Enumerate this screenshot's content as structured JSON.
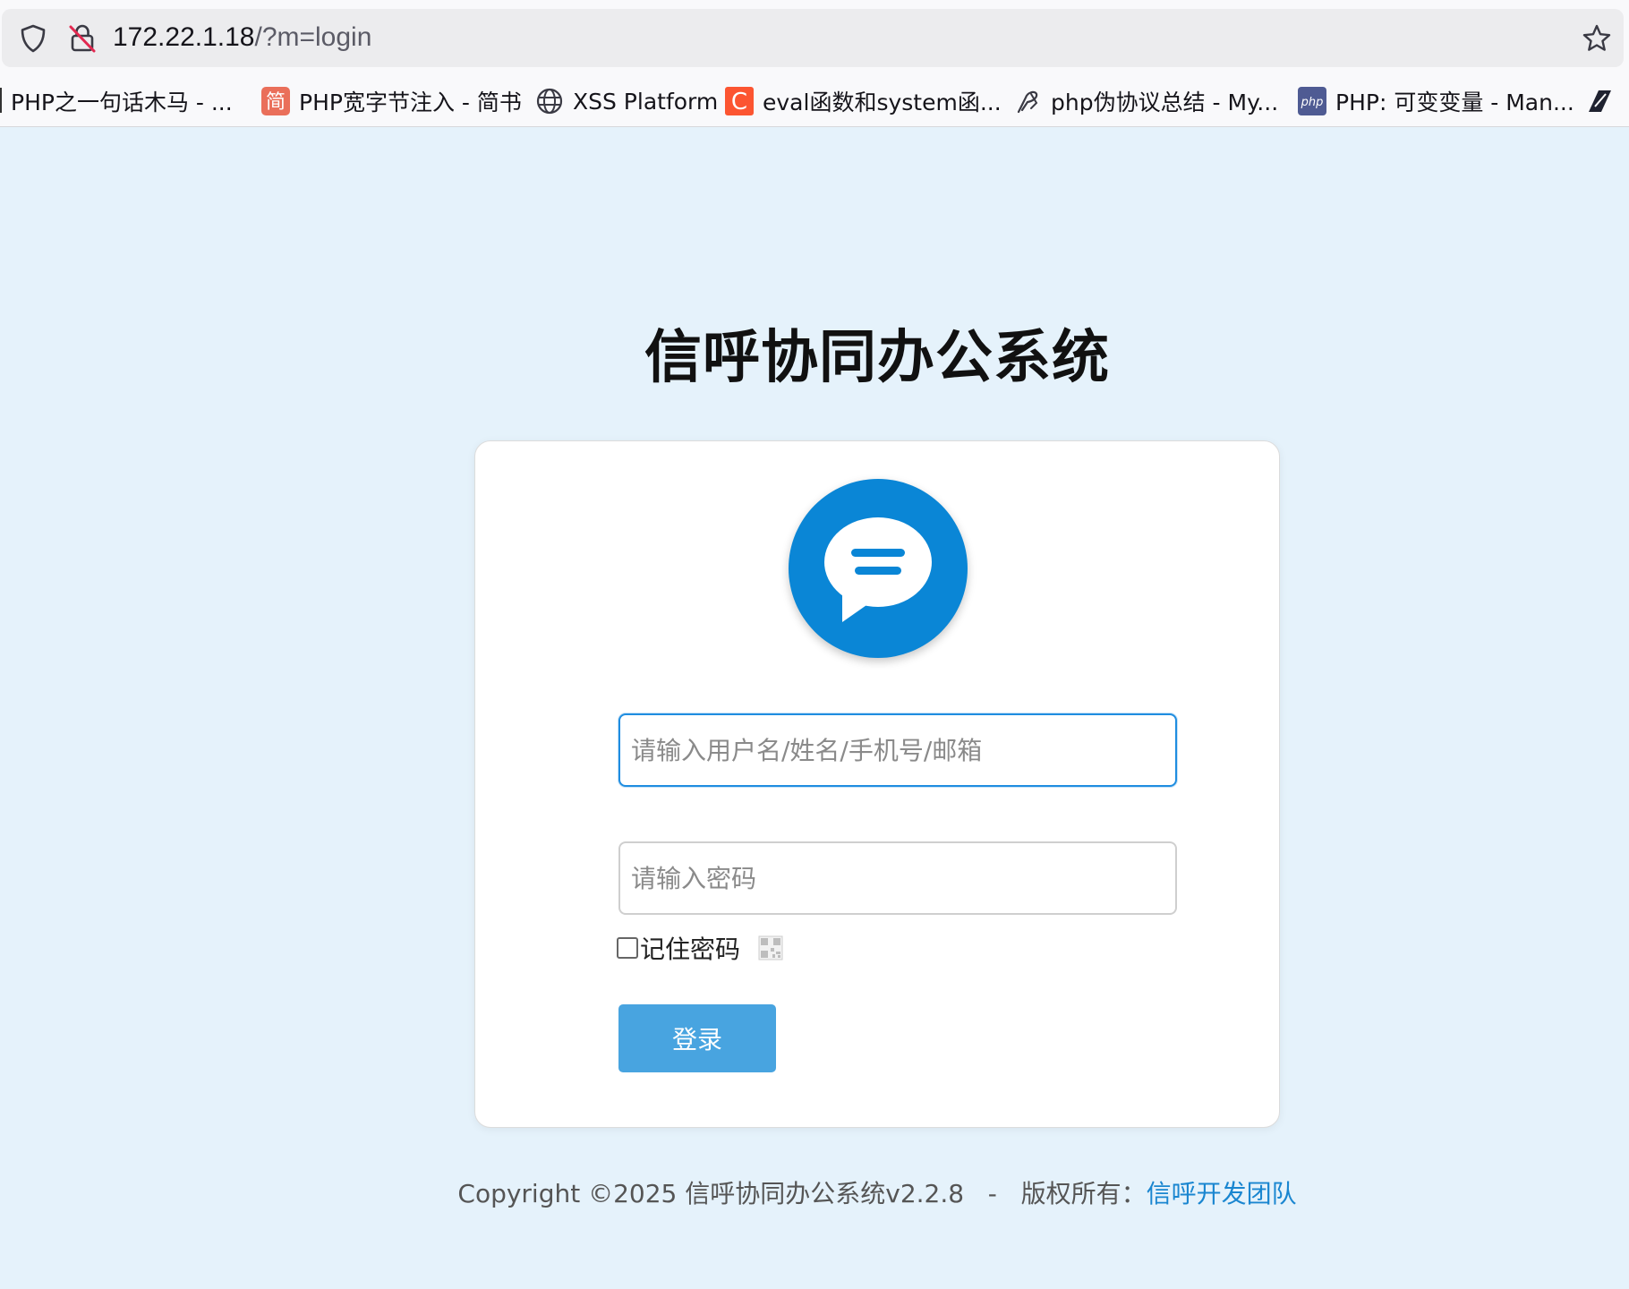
{
  "browser": {
    "url_host": "172.22.1.18",
    "url_path": "/?m=login",
    "bookmarks": [
      {
        "label": "PHP之一句话木马 - ...",
        "icon": "none"
      },
      {
        "label": "PHP宽字节注入 - 简书",
        "icon": "jianshu-icon",
        "icon_text": "简"
      },
      {
        "label": "XSS Platform",
        "icon": "globe-icon"
      },
      {
        "label": "eval函数和system函...",
        "icon": "csdn-icon",
        "icon_text": "C"
      },
      {
        "label": "php伪协议总结 - My...",
        "icon": "feather-icon"
      },
      {
        "label": "PHP: 可变变量 - Man...",
        "icon": "php-icon",
        "icon_text": "php"
      },
      {
        "label": "",
        "icon": "zhihu-icon"
      }
    ]
  },
  "page": {
    "title": "信呼协同办公系统",
    "username_placeholder": "请输入用户名/姓名/手机号/邮箱",
    "password_placeholder": "请输入密码",
    "remember_label": "记住密码",
    "login_label": "登录",
    "footer_prefix": "Copyright ©2025 信呼协同办公系统v2.2.8   -   版权所有：",
    "footer_link": "信呼开发团队"
  },
  "colors": {
    "page_bg": "#e5f2fb",
    "logo_blue": "#0a86d6",
    "button_blue": "#48a4e0",
    "link_blue": "#1a86d0"
  }
}
